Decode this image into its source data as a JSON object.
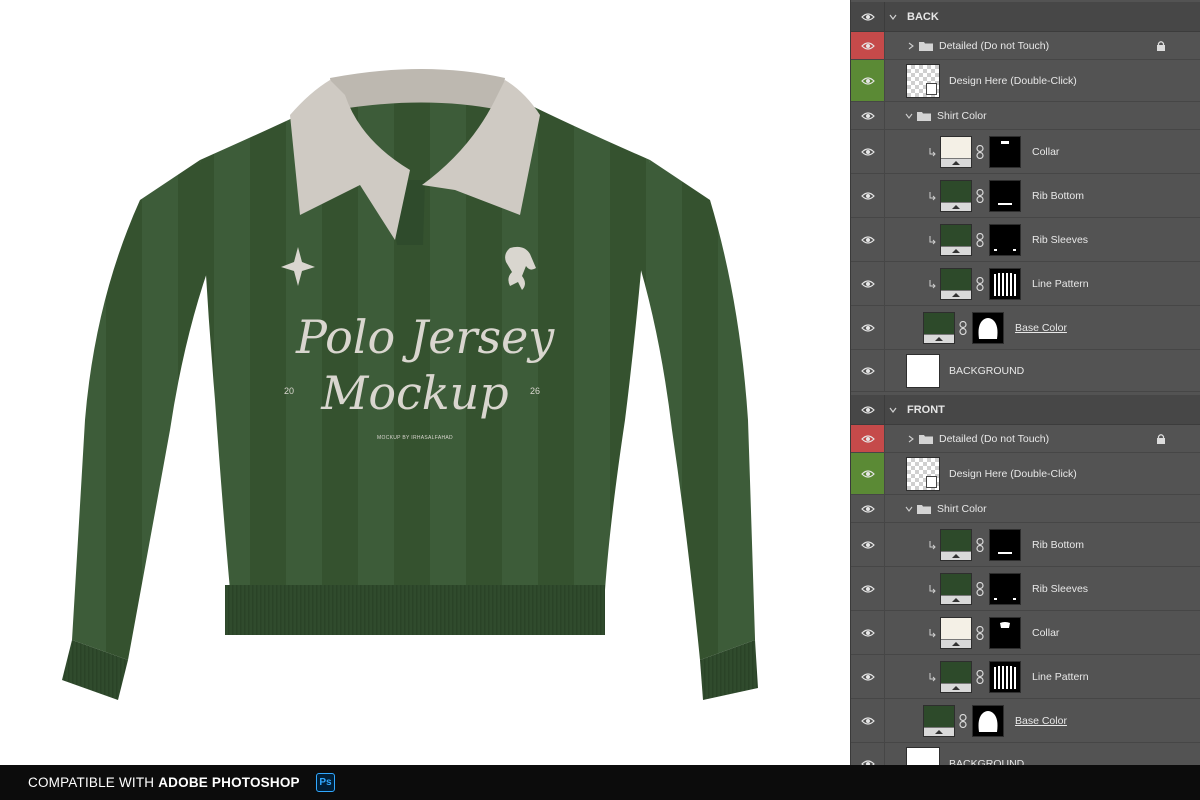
{
  "mockup": {
    "title_line1": "Polo Jersey",
    "title_line2": "Mockup",
    "year_left": "20",
    "year_right": "26",
    "credit": "MOCKUP BY IRHASALFAHAD",
    "shirt_color": "#3b5a37",
    "collar_color": "#cfcac3"
  },
  "layers": {
    "back_group": "BACK",
    "front_group": "FRONT",
    "back": [
      {
        "label": "Detailed (Do not Touch)",
        "kind": "folder-locked"
      },
      {
        "label": "Design Here (Double-Click)",
        "kind": "smart-object"
      },
      {
        "label": "Shirt Color",
        "kind": "folder-open"
      },
      {
        "label": "Collar",
        "kind": "fill",
        "color": "#f4f0e6",
        "mask": "collar"
      },
      {
        "label": "Rib Bottom",
        "kind": "fill",
        "color": "#2d4a2a",
        "mask": "rib-bottom"
      },
      {
        "label": "Rib Sleeves",
        "kind": "fill",
        "color": "#2d4a2a",
        "mask": "rib-sleeves"
      },
      {
        "label": "Line Pattern",
        "kind": "fill",
        "color": "#2d4a2a",
        "mask": "lines"
      },
      {
        "label": "Base Color",
        "kind": "fill-base",
        "color": "#2d4a2a",
        "mask": "shirt"
      },
      {
        "label": "BACKGROUND",
        "kind": "background"
      }
    ],
    "front": [
      {
        "label": "Detailed (Do not Touch)",
        "kind": "folder-locked"
      },
      {
        "label": "Design Here (Double-Click)",
        "kind": "smart-object"
      },
      {
        "label": "Shirt Color",
        "kind": "folder-open"
      },
      {
        "label": "Rib Bottom",
        "kind": "fill",
        "color": "#2d4a2a",
        "mask": "rib-bottom"
      },
      {
        "label": "Rib Sleeves",
        "kind": "fill",
        "color": "#2d4a2a",
        "mask": "rib-sleeves"
      },
      {
        "label": "Collar",
        "kind": "fill",
        "color": "#f4f0e6",
        "mask": "collar-front"
      },
      {
        "label": "Line Pattern",
        "kind": "fill",
        "color": "#2d4a2a",
        "mask": "lines"
      },
      {
        "label": "Base Color",
        "kind": "fill-base",
        "color": "#2d4a2a",
        "mask": "shirt"
      },
      {
        "label": "BACKGROUND",
        "kind": "background"
      }
    ]
  },
  "footer": {
    "prefix": "COMPATIBLE WITH ",
    "product": "ADOBE PHOTOSHOP",
    "badge": "Ps"
  },
  "colors": {
    "eye_red": "#c54a4a",
    "eye_green": "#5b8a35",
    "panel_bg": "#535353"
  }
}
